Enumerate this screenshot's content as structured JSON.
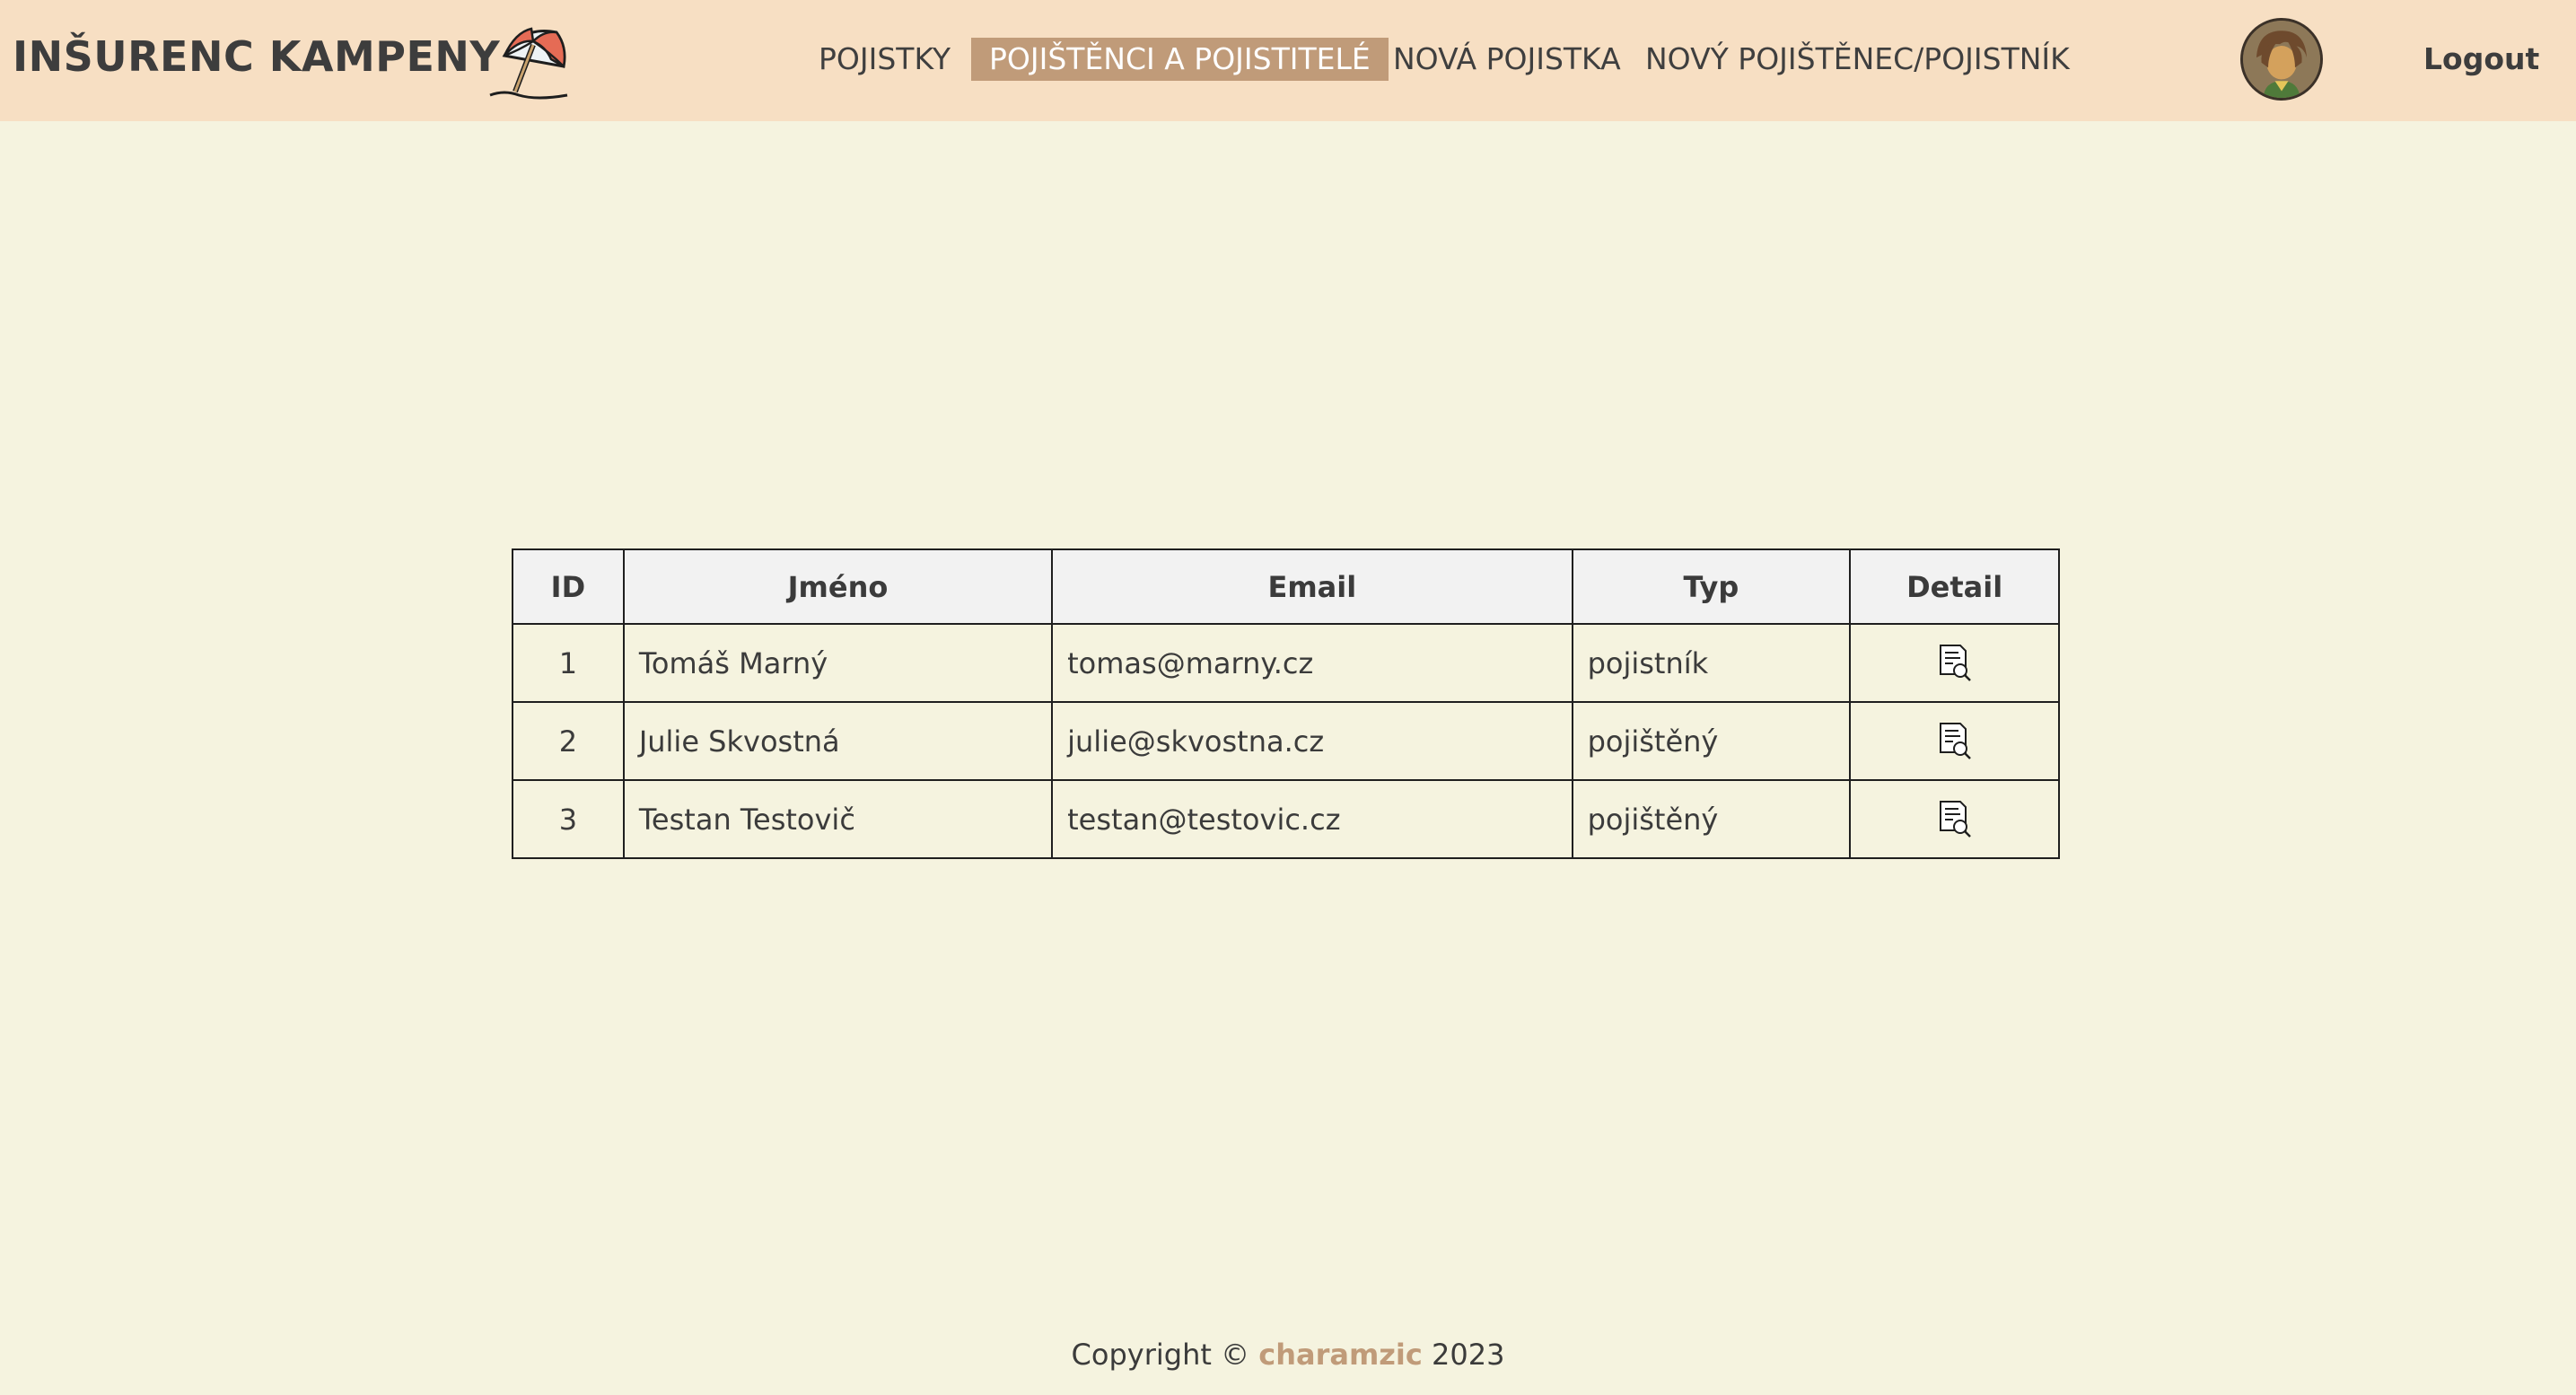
{
  "header": {
    "brand": "INŠURENC KAMPENY",
    "logo_icon": "beach-umbrella-icon",
    "nav": [
      {
        "label": "POJISTKY",
        "active": false
      },
      {
        "label": "POJIŠTĚNCI A POJISTITELÉ",
        "active": true
      },
      {
        "label": "NOVÁ POJISTKA",
        "active": false
      },
      {
        "label": "NOVÝ POJIŠTĚNEC/POJISTNÍK",
        "active": false
      }
    ],
    "avatar_icon": "user-avatar-icon",
    "logout": "Logout"
  },
  "table": {
    "headers": [
      "ID",
      "Jméno",
      "Email",
      "Typ",
      "Detail"
    ],
    "rows": [
      {
        "id": "1",
        "name": "Tomáš Marný",
        "email": "tomas@marny.cz",
        "type": "pojistník",
        "detail_icon": "document-search-icon"
      },
      {
        "id": "2",
        "name": "Julie Skvostná",
        "email": "julie@skvostna.cz",
        "type": "pojištěný",
        "detail_icon": "document-search-icon"
      },
      {
        "id": "3",
        "name": "Testan Testovič",
        "email": "testan@testovic.cz",
        "type": "pojištěný",
        "detail_icon": "document-search-icon"
      }
    ]
  },
  "footer": {
    "prefix": "Copyright ©",
    "author": "charamzic",
    "year": "2023"
  },
  "colors": {
    "header_bg": "#f7dfc3",
    "page_bg": "#f5f3df",
    "accent": "#c09b79",
    "table_header_bg": "#f2f2f2"
  }
}
